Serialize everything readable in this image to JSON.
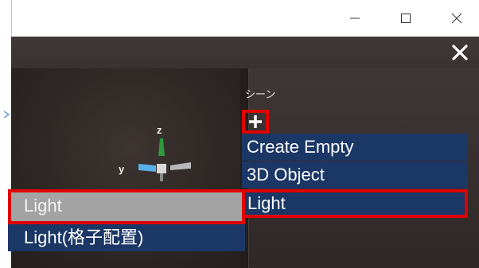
{
  "window_controls": {
    "minimize_icon": "minimize-icon",
    "maximize_icon": "maximize-icon",
    "close_icon": "close-icon"
  },
  "app": {
    "close_icon": "close-x-icon"
  },
  "viewport": {
    "gizmo": {
      "z_label": "z",
      "y_label": "y"
    }
  },
  "scene_panel": {
    "title": "シーン",
    "add_icon": "plus-icon",
    "menu": [
      "Create Empty",
      "3D Object",
      "Light"
    ]
  },
  "light_submenu": {
    "items": [
      "Light",
      "Light(格子配置)"
    ]
  },
  "colors": {
    "menu_bg": "#1b3766",
    "highlight": "#e00000",
    "hover_item": "#a3a3a3"
  }
}
